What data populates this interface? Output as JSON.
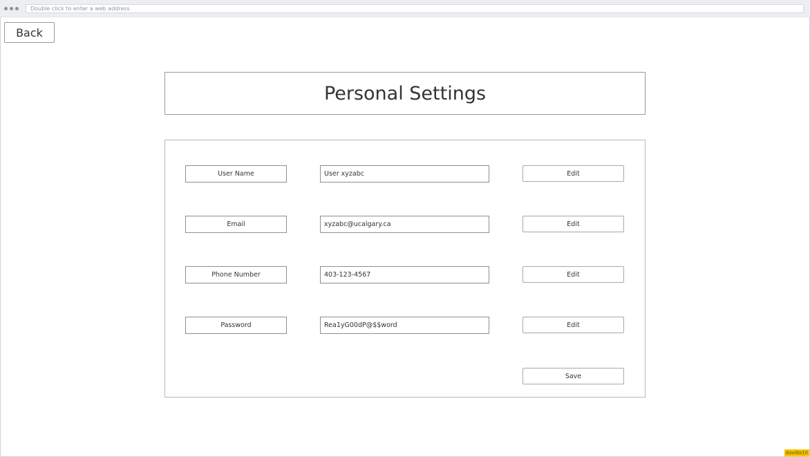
{
  "browser": {
    "address_placeholder": "Double click to enter a web address"
  },
  "nav": {
    "back_label": "Back"
  },
  "page": {
    "title": "Personal Settings"
  },
  "settings": {
    "rows": [
      {
        "label": "User Name",
        "value": "User xyzabc",
        "action": "Edit"
      },
      {
        "label": "Email",
        "value": "xyzabc@ucalgary.ca",
        "action": "Edit"
      },
      {
        "label": "Phone Number",
        "value": "403-123-4567",
        "action": "Edit"
      },
      {
        "label": "Password",
        "value": "Rea1yG00dP@$$word",
        "action": "Edit"
      }
    ],
    "save_label": "Save"
  },
  "watermark": {
    "text": "davida10"
  }
}
